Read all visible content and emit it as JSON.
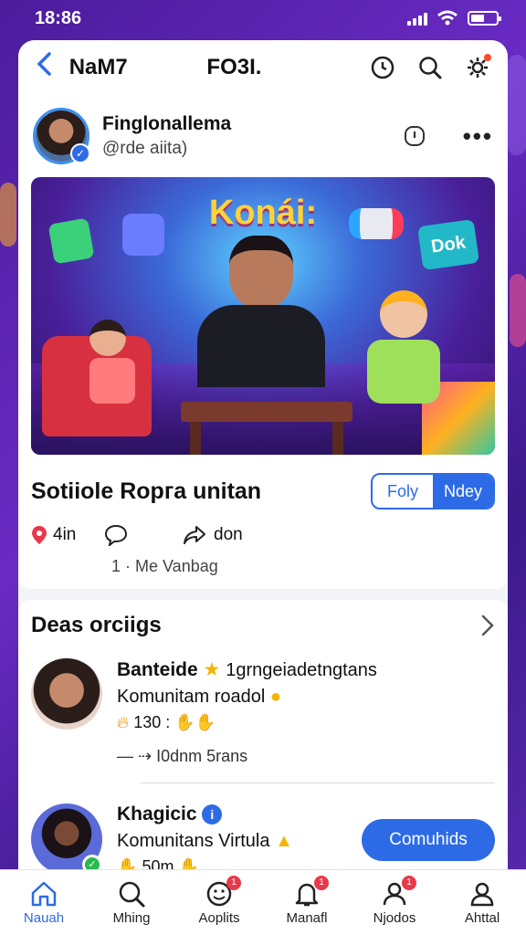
{
  "status_bar": {
    "time": "18:86"
  },
  "topbar": {
    "app_title": "NaM7",
    "tab_title": "FO3I."
  },
  "profile": {
    "name": "Finglonallema",
    "handle": "@rde aiita)"
  },
  "post": {
    "hero_title": "Konái:",
    "hero_badge": "Dok",
    "title": "Sotiiole  Rорга unitan",
    "toggle": [
      "Foly",
      "Ndey"
    ],
    "likes": "4in",
    "shares": "don",
    "sub": "1 · Me   Vanbag"
  },
  "section": {
    "title": "Deas orciigs",
    "items": [
      {
        "name": "Banteide",
        "sub": "1grngeiadetngtans",
        "line": "Komunitam roadol",
        "meta": "130 :",
        "foot": "— ⇢ I0dnm 5rans"
      },
      {
        "name": "Khagicic",
        "line": "Komunitans Virtula",
        "meta": "50m",
        "button": "Comuhids"
      }
    ]
  },
  "nav": [
    {
      "label": "Nauah",
      "icon": "home-icon",
      "badge": ""
    },
    {
      "label": "Mhing",
      "icon": "search-icon",
      "badge": ""
    },
    {
      "label": "Aoplits",
      "icon": "smiley-icon",
      "badge": "1"
    },
    {
      "label": "Manafl",
      "icon": "bell-icon",
      "badge": "1"
    },
    {
      "label": "Njodos",
      "icon": "people-icon",
      "badge": "1"
    },
    {
      "label": "Ahttal",
      "icon": "profile-icon",
      "badge": ""
    }
  ],
  "colors": {
    "accent": "#2d6be6",
    "background": "#5a2ab0",
    "badge": "#e8384a"
  }
}
